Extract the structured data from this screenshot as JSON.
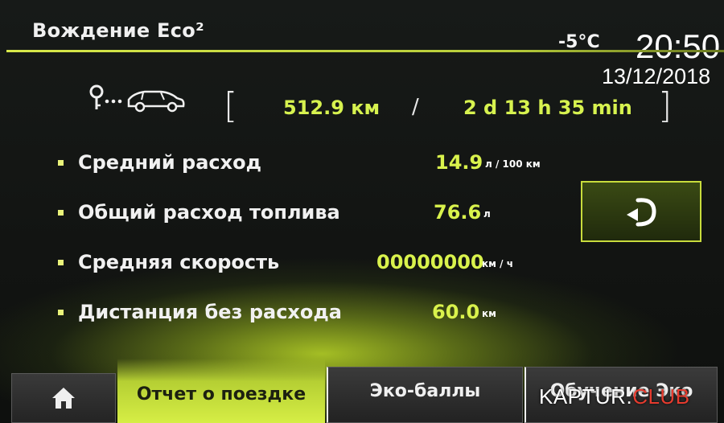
{
  "header": {
    "title": "Вождение Eco²",
    "temperature": "-5°C",
    "time": "20:50",
    "date": "13/12/2018"
  },
  "trip": {
    "distance": "512.9 км",
    "separator": "/",
    "duration": "2 d 13 h 35 min",
    "bracket_open": "[",
    "bracket_close": "]"
  },
  "stats": [
    {
      "label": "Средний расход",
      "value": "14.9",
      "unit": "л / 100 км"
    },
    {
      "label": "Общий расход топлива",
      "value": "76.6",
      "unit": "л"
    },
    {
      "label": "Средняя скорость",
      "value": "00000000",
      "unit": "км / ч"
    },
    {
      "label": "Дистанция без расхода",
      "value": "60.0",
      "unit": "км"
    }
  ],
  "reset_button": {
    "icon": "reset-arrow-icon"
  },
  "tabs": {
    "home_icon": "home-icon",
    "report": "Отчет о поездке",
    "eco_points": "Эко-баллы",
    "eco_learning": "Обучение Эко"
  },
  "watermark": {
    "brand": "KAPTUR.",
    "club": "CLUB"
  },
  "colors": {
    "accent_green": "#d7f24f",
    "header_line": "#c8dc3c",
    "background": "#121412",
    "watermark_red": "#e63b2e"
  }
}
